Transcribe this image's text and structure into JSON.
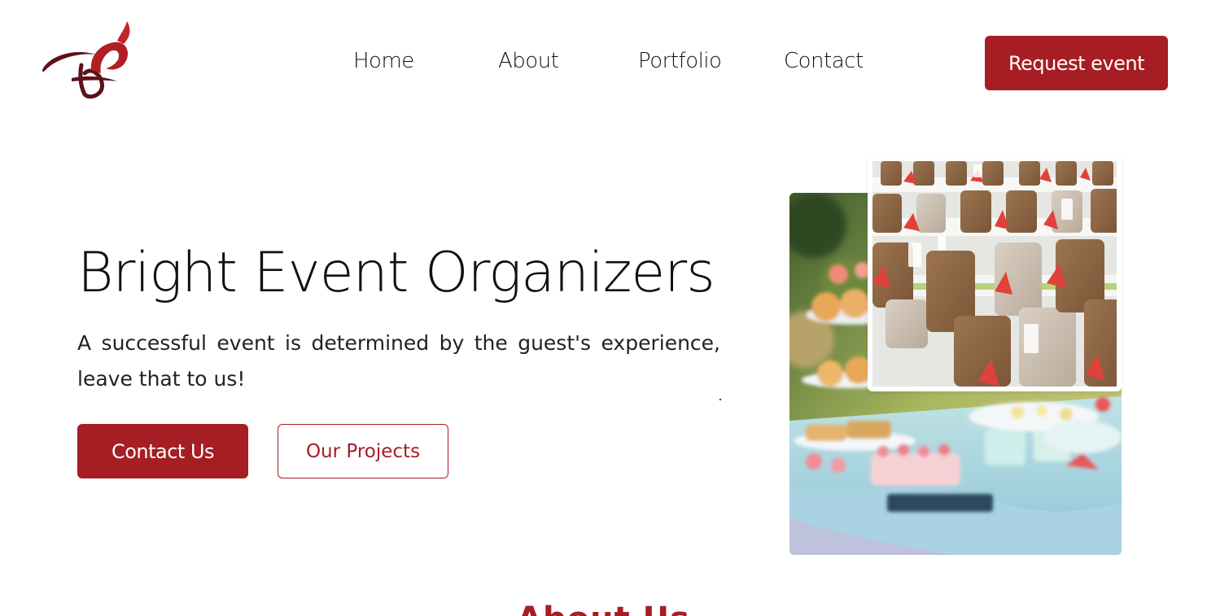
{
  "brand": {
    "logo_icon": "monogram-flourish-logo",
    "accent_color": "#a71d24"
  },
  "nav": {
    "items": [
      {
        "label": "Home"
      },
      {
        "label": "About"
      },
      {
        "label": "Portfolio"
      },
      {
        "label": "Contact"
      }
    ],
    "cta_label": "Request event"
  },
  "hero": {
    "title": "Bright Event Organizers",
    "subtitle": "A successful event is determined by the guest's experience, leave that to us!",
    "primary_button": "Contact Us",
    "secondary_button": "Our Projects"
  },
  "next_section": {
    "heading": "About Us"
  }
}
